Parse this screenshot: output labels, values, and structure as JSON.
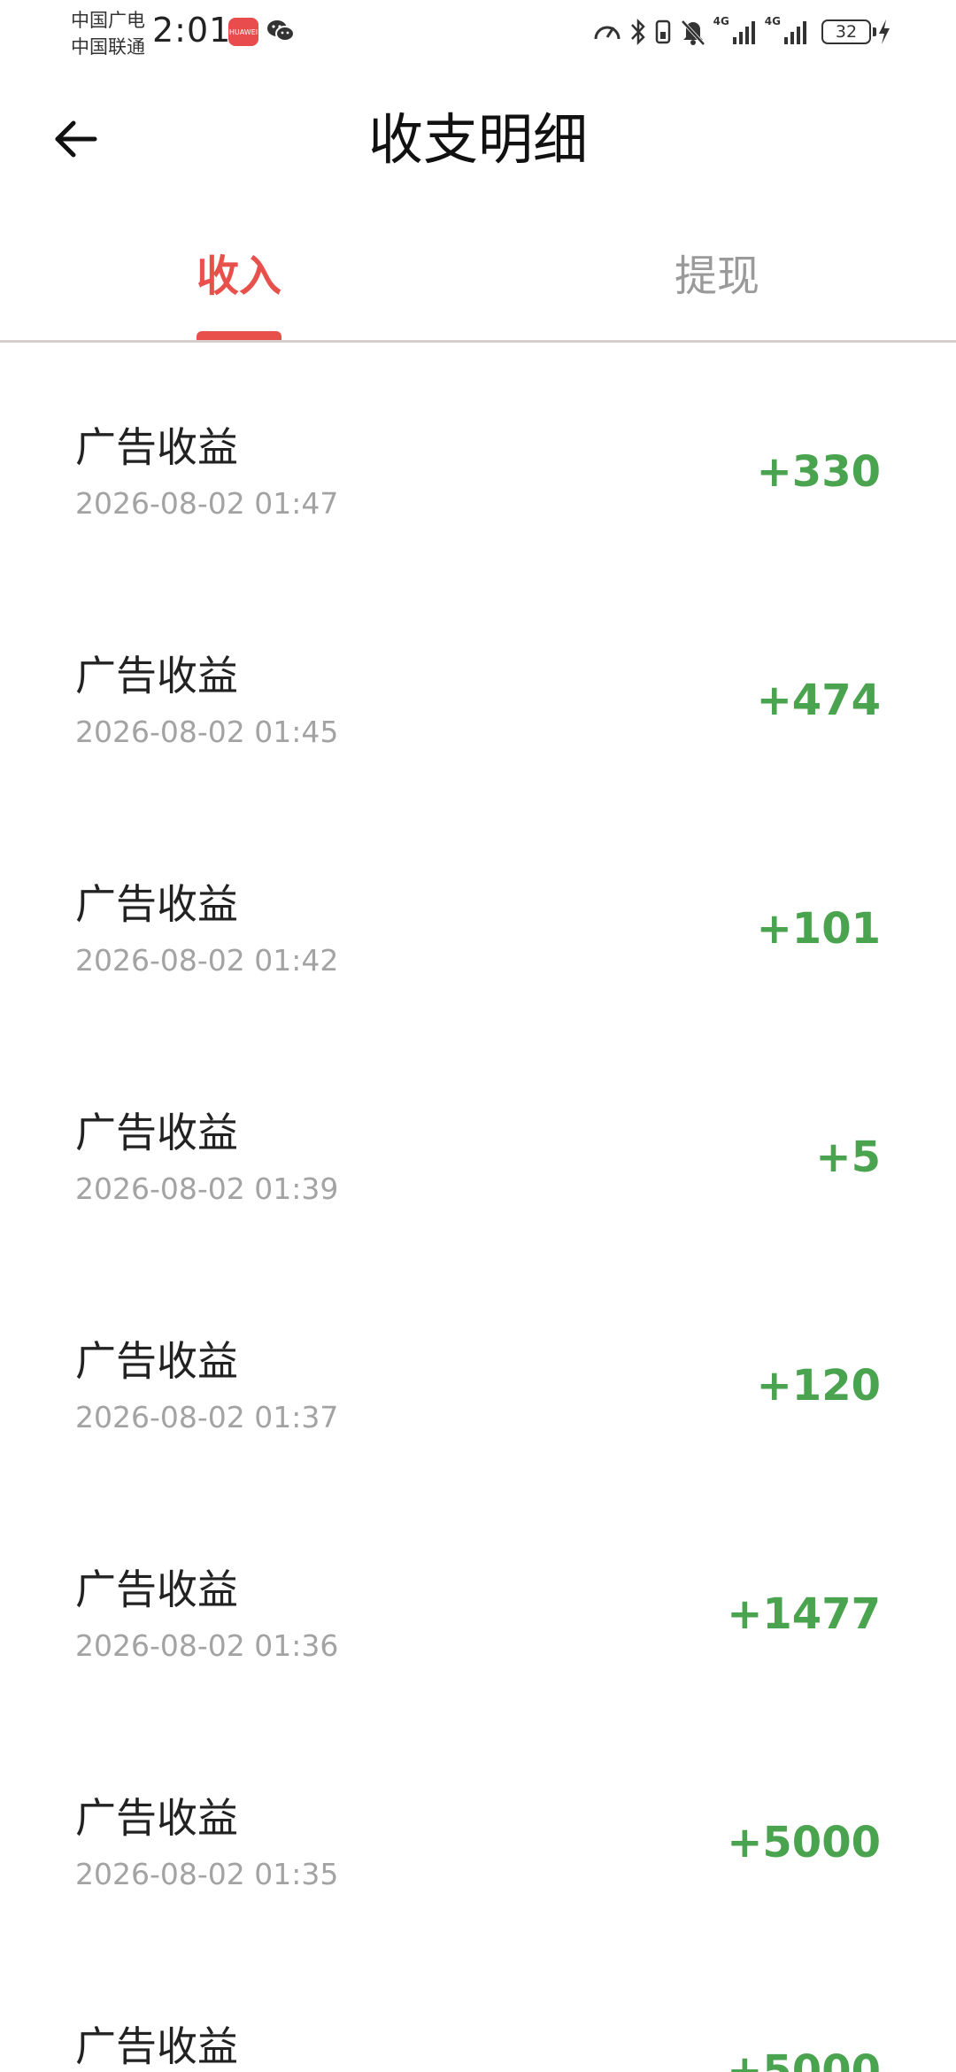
{
  "status_bar": {
    "carrier_1": "中国广电",
    "carrier_2": "中国联通",
    "time": "2:01",
    "app_badge": "HUAWEI",
    "net_1": "4G",
    "net_2": "4G",
    "battery": "32"
  },
  "header": {
    "title": "收支明细",
    "back_icon": "arrow-left-icon"
  },
  "tabs": [
    {
      "label": "收入",
      "active": true
    },
    {
      "label": "提现",
      "active": false
    }
  ],
  "colors": {
    "accent": "#e8504c",
    "amount": "#4aa34e",
    "muted": "#a3a3a3"
  },
  "records": [
    {
      "title": "广告收益",
      "time": "2026-08-02 01:47",
      "amount": "+330"
    },
    {
      "title": "广告收益",
      "time": "2026-08-02 01:45",
      "amount": "+474"
    },
    {
      "title": "广告收益",
      "time": "2026-08-02 01:42",
      "amount": "+101"
    },
    {
      "title": "广告收益",
      "time": "2026-08-02 01:39",
      "amount": "+5"
    },
    {
      "title": "广告收益",
      "time": "2026-08-02 01:37",
      "amount": "+120"
    },
    {
      "title": "广告收益",
      "time": "2026-08-02 01:36",
      "amount": "+1477"
    },
    {
      "title": "广告收益",
      "time": "2026-08-02 01:35",
      "amount": "+5000"
    },
    {
      "title": "广告收益",
      "time": "",
      "amount": "+5000"
    }
  ]
}
